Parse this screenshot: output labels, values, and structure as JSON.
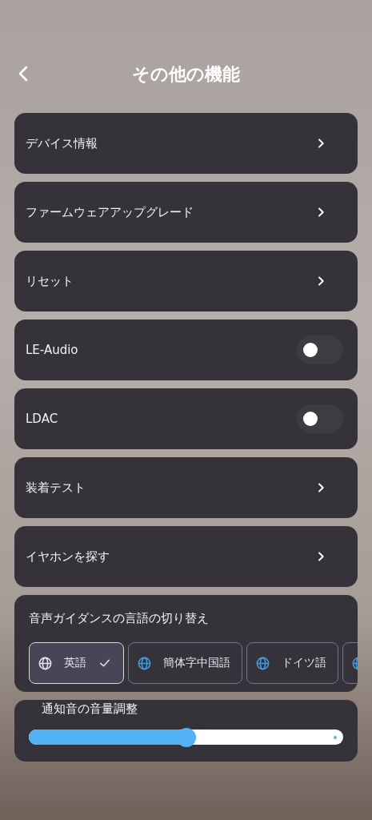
{
  "header": {
    "title": "その他の機能"
  },
  "items": [
    {
      "kind": "link",
      "label": "デバイス情報"
    },
    {
      "kind": "link",
      "label": "ファームウェアアップグレード"
    },
    {
      "kind": "link",
      "label": "リセット"
    },
    {
      "kind": "toggle",
      "label": "LE-Audio",
      "on": false
    },
    {
      "kind": "toggle",
      "label": "LDAC",
      "on": false
    },
    {
      "kind": "link",
      "label": "装着テスト"
    },
    {
      "kind": "link",
      "label": "イヤホンを探す"
    }
  ],
  "language": {
    "title": "音声ガイダンスの言語の切り替え",
    "options": [
      {
        "label": "英語",
        "selected": true
      },
      {
        "label": "簡体字中国語",
        "selected": false
      },
      {
        "label": "ドイツ語",
        "selected": false
      },
      {
        "selected": false
      }
    ]
  },
  "volume": {
    "title": "通知音の音量調整",
    "level": 0.5
  }
}
